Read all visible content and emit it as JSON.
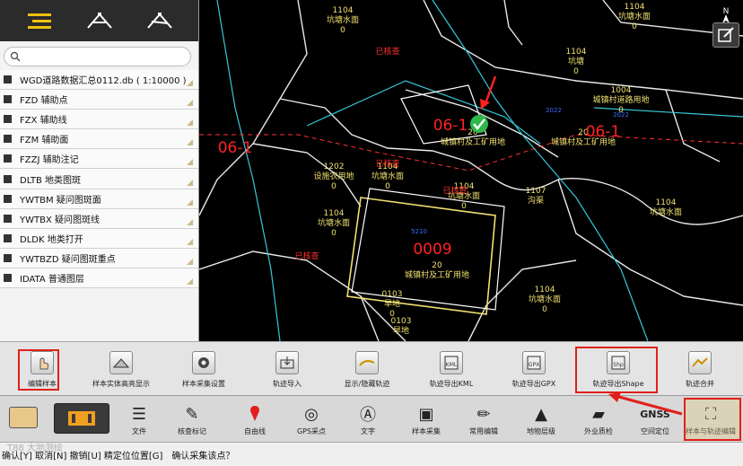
{
  "panel": {
    "search_placeholder": "",
    "layers": [
      {
        "label": "WGD道路数据汇总0112.db ( 1:10000 )"
      },
      {
        "label": "FZD 辅助点"
      },
      {
        "label": "FZX 辅助线"
      },
      {
        "label": "FZM 辅助面"
      },
      {
        "label": "FZZJ 辅助注记"
      },
      {
        "label": "DLTB 地类图斑"
      },
      {
        "label": "YWTBM 疑问图斑面"
      },
      {
        "label": "YWTBX 疑问图斑线"
      },
      {
        "label": "DLDK 地类打开"
      },
      {
        "label": "YWTBZD 疑问图斑重点"
      },
      {
        "label": "IDATA 普通图层"
      }
    ]
  },
  "map": {
    "compass": "N",
    "labels": [
      {
        "code": "1104",
        "name": "坑塘水面",
        "num": "0"
      },
      {
        "code": "1104",
        "name": "坑塘水面",
        "num": "0"
      },
      {
        "code": "1004",
        "name": "城镇村道路用地",
        "num": "0"
      },
      {
        "code": "20",
        "name": "城镇村及工矿用地",
        "num": ""
      },
      {
        "code": "20",
        "name": "城镇村及工矿用地",
        "num": ""
      },
      {
        "code": "1202",
        "name": "设施农用地",
        "num": "0"
      },
      {
        "code": "1104",
        "name": "坑塘水面",
        "num": "0"
      },
      {
        "code": "1104",
        "name": "坑塘水面",
        "num": "0"
      },
      {
        "code": "1107",
        "name": "沟渠",
        "num": ""
      },
      {
        "code": "1104",
        "name": "坑塘水面",
        "num": "0"
      },
      {
        "code": "20",
        "name": "城镇村及工矿用地",
        "num": ""
      },
      {
        "code": "1104",
        "name": "坑塘水面",
        "num": "0"
      },
      {
        "code": "0103",
        "name": "旱地",
        "num": "0"
      },
      {
        "code": "0103",
        "name": "旱地",
        "num": ""
      },
      {
        "code": "1104",
        "name": "坑塘水面",
        "num": ""
      },
      {
        "code": "1104",
        "name": "坑塘",
        "num": "0"
      }
    ],
    "parcel_ids": [
      "06-1",
      "06-1",
      "06-1",
      "0009"
    ],
    "red_tags": [
      "已核查",
      "已核查",
      "已核查",
      "已核查"
    ],
    "blue_tags": [
      "2022",
      "5210",
      "2022"
    ]
  },
  "toolbar1": {
    "items": [
      {
        "label": "编辑样本",
        "icon": "hand-edit-icon"
      },
      {
        "label": "样本实体高亮显示",
        "icon": "highlight-icon"
      },
      {
        "label": "样本采集设置",
        "icon": "settings-icon"
      },
      {
        "label": "轨迹导入",
        "icon": "import-icon"
      },
      {
        "label": "显示/隐藏轨迹",
        "icon": "track-visibility-icon"
      },
      {
        "label": "轨迹导出KML",
        "icon": "export-kml-icon"
      },
      {
        "label": "轨迹导出GPX",
        "icon": "export-gpx-icon"
      },
      {
        "label": "轨迹导出Shape",
        "icon": "export-shape-icon"
      },
      {
        "label": "轨迹合并",
        "icon": "merge-icon"
      }
    ],
    "export_kml_caption": "KML",
    "export_gpx_caption": "GPX",
    "export_shape_caption": "Shp"
  },
  "toolbar2": {
    "items": [
      {
        "label": "文件",
        "icon": "list-icon"
      },
      {
        "label": "核查标记",
        "icon": "check-mark-icon"
      },
      {
        "label": "自由线",
        "icon": "pin-icon"
      },
      {
        "label": "GPS采点",
        "icon": "gps-icon"
      },
      {
        "label": "文字",
        "icon": "text-icon"
      },
      {
        "label": "样本采集",
        "icon": "sample-collect-icon"
      },
      {
        "label": "常用编辑",
        "icon": "pen-icon"
      },
      {
        "label": "地物层级",
        "icon": "layer-level-icon"
      },
      {
        "label": "外业质检",
        "icon": "inspect-icon"
      },
      {
        "label": "空间定位",
        "icon": "gnss-icon"
      },
      {
        "label": "样本与轨迹编辑",
        "icon": "track-edit-icon"
      }
    ],
    "gnss_text": "GNSS"
  },
  "status": {
    "text1": "确认[Y] 取消[N] 撤销[U] 精定位位置[G]",
    "text2": "确认采集该点？"
  },
  "watermark": "T88 大地测绘",
  "colors": {
    "highlight_red": "#e0201a",
    "map_line_white": "#e8e8e8",
    "map_line_cyan": "#35c8d8",
    "map_label_yellow": "#f0e070",
    "parcel_red": "#ff2222",
    "green_check": "#2fb84a"
  }
}
